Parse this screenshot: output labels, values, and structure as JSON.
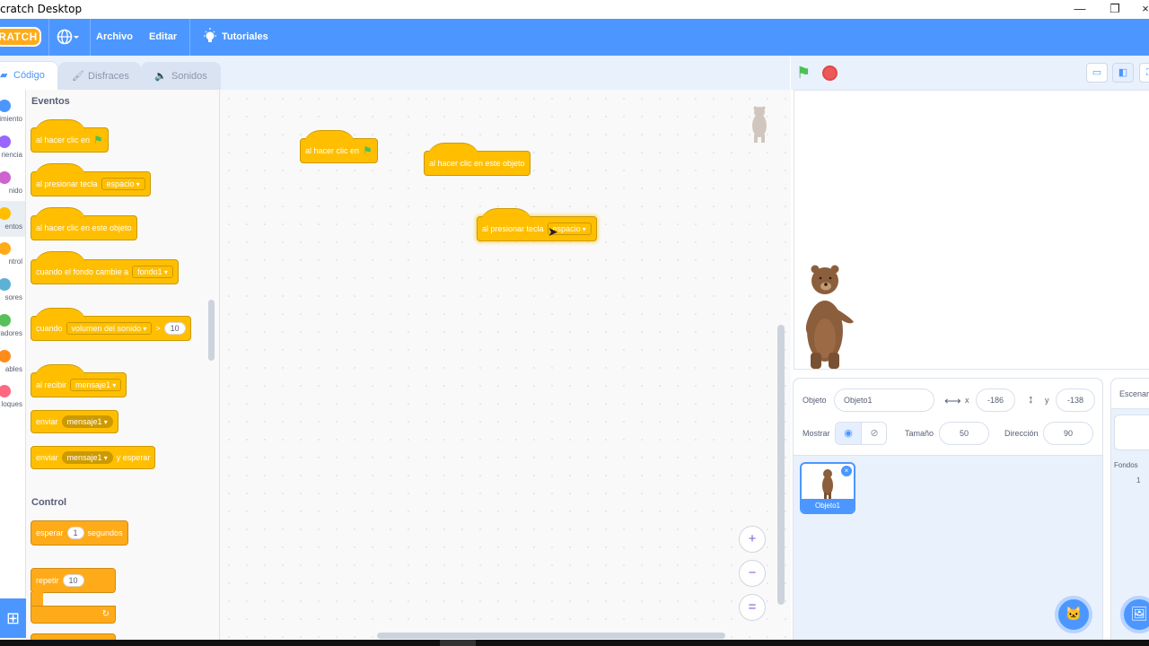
{
  "window": {
    "title": "cratch Desktop",
    "controls": {
      "minimize": "—",
      "restore": "❐",
      "close": "×"
    }
  },
  "menubar": {
    "logo": "RATCH",
    "language_icon": "globe-icon",
    "items": [
      "Archivo",
      "Editar"
    ],
    "tutorials": "Tutoriales"
  },
  "tabs": [
    {
      "label": "Código",
      "icon": "code-icon",
      "active": true
    },
    {
      "label": "Disfraces",
      "icon": "brush-icon",
      "active": false
    },
    {
      "label": "Sonidos",
      "icon": "speaker-icon",
      "active": false
    }
  ],
  "categories": [
    {
      "label": "imiento",
      "color": "#4c97ff"
    },
    {
      "label": "riencia",
      "color": "#9966ff"
    },
    {
      "label": "nido",
      "color": "#cf63cf"
    },
    {
      "label": "entos",
      "color": "#ffbf00",
      "selected": true
    },
    {
      "label": "ntrol",
      "color": "#ffab19"
    },
    {
      "label": "sores",
      "color": "#5cb1d6"
    },
    {
      "label": "radores",
      "color": "#59c059"
    },
    {
      "label": "ables",
      "color": "#ff8c1a"
    },
    {
      "label": "loques",
      "color": "#ff6680"
    }
  ],
  "palette": {
    "events_heading": "Eventos",
    "control_heading": "Control",
    "blocks": {
      "when_flag": "al hacer clic en",
      "when_key": "al presionar tecla",
      "key_value": "espacio",
      "when_sprite_clicked": "al hacer clic en este objeto",
      "when_backdrop": "cuando el fondo cambie a",
      "backdrop_value": "fondo1",
      "when_gt": "cuando",
      "sensor_value": "volumen del sonido",
      "gt_symbol": ">",
      "gt_number": "10",
      "when_receive": "al recibir",
      "message_value": "mensaje1",
      "broadcast": "enviar",
      "broadcast_wait_suffix": "y esperar",
      "wait": "esperar",
      "wait_number": "1",
      "wait_unit": "segundos",
      "repeat": "repetir",
      "repeat_number": "10"
    }
  },
  "script_area": {
    "blocks": [
      {
        "text": "al hacer clic en",
        "flag": true
      },
      {
        "text": "al hacer clic en este objeto"
      },
      {
        "text": "al presionar tecla",
        "dropdown": "espacio"
      }
    ],
    "zoom": {
      "in": "+",
      "out": "−",
      "reset": "="
    }
  },
  "stage_controls": {
    "green_flag": "green-flag-icon",
    "stop": "stop-icon",
    "layout_small": "small-stage-icon",
    "layout_normal": "normal-stage-icon"
  },
  "sprite_info": {
    "sprite_label": "Objeto",
    "sprite_name": "Objeto1",
    "x_label": "x",
    "x_value": "-186",
    "y_label": "y",
    "y_value": "-138",
    "show_label": "Mostrar",
    "size_label": "Tamaño",
    "size_value": "50",
    "direction_label": "Dirección",
    "direction_value": "90"
  },
  "sprites": [
    {
      "name": "Objeto1",
      "selected": true
    }
  ],
  "stage_pane": {
    "title": "Escenar",
    "backdrops_label": "Fondos",
    "backdrops_count": "1"
  },
  "colors": {
    "menubar": "#4c97ff",
    "events": "#ffbf00",
    "control": "#ffab19",
    "accent": "#4c97ff"
  }
}
